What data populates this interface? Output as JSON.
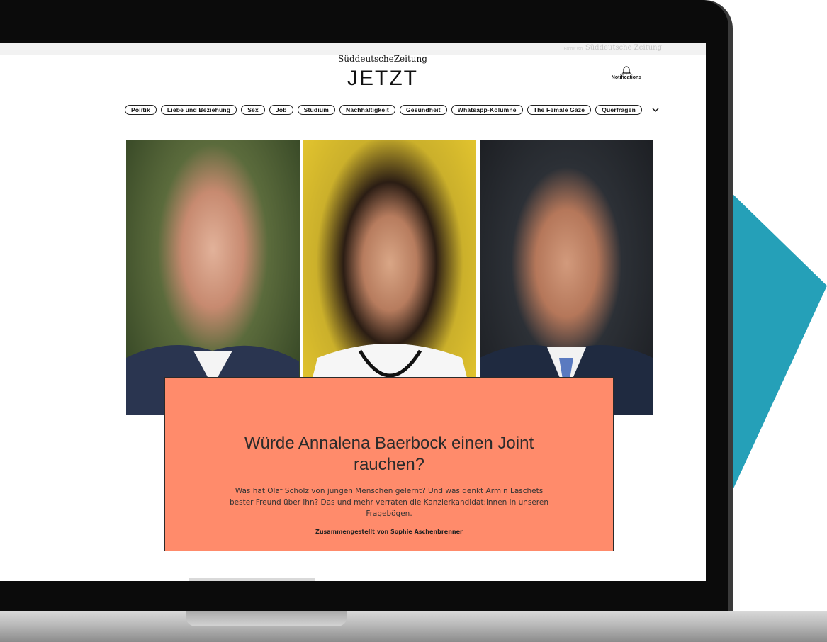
{
  "partner": {
    "prefix": "Partner von",
    "name": "Süddeutsche Zeitung"
  },
  "brand": {
    "publisher": "SüddeutscheZeitung",
    "title": "JETZT"
  },
  "notifications": {
    "label": "Notifications",
    "icon": "bell-icon"
  },
  "nav": {
    "items": [
      "Politik",
      "Liebe und Beziehung",
      "Sex",
      "Job",
      "Studium",
      "Nachhaltigkeit",
      "Gesundheit",
      "Whatsapp-Kolumne",
      "The Female Gaze",
      "Querfragen"
    ],
    "more_icon": "chevron-down-icon"
  },
  "article": {
    "headline": "Würde Annalena Baerbock einen Joint rauchen?",
    "teaser": "Was hat Olaf Scholz von jungen Menschen gelernt? Und was denkt Armin Laschets bester Freund über ihn? Das und mehr verraten die Kanzlerkandidat:innen in unseren Fragebögen.",
    "author": "Zusammengestellt von Sophie Aschenbrenner",
    "card_color": "#ff8b6b"
  },
  "colors": {
    "accent_teal": "#25a0b8"
  }
}
